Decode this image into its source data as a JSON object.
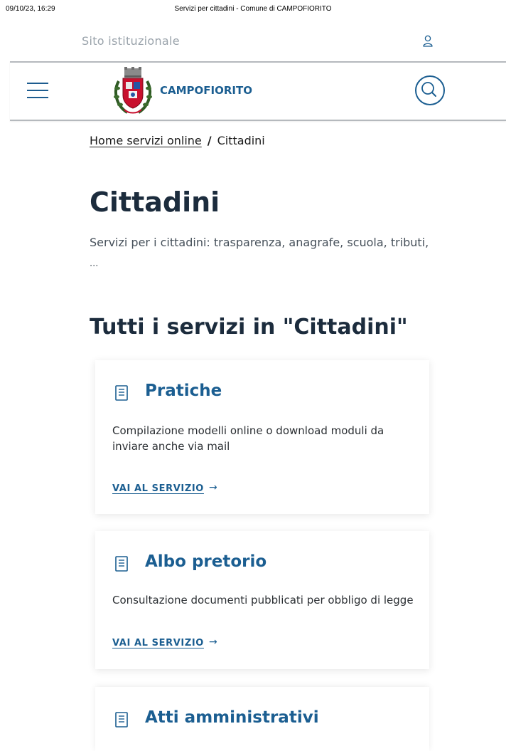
{
  "print_header": {
    "date": "09/10/23, 16:29",
    "title": "Servizi per cittadini - Comune di CAMPOFIORITO"
  },
  "slim_header": {
    "label": "Sito istituzionale",
    "user_icon": "user-icon"
  },
  "header": {
    "menu_icon": "hamburger-icon",
    "crest_icon": "municipal-crest-icon",
    "brand": "CAMPOFIORITO",
    "search_icon": "search-icon"
  },
  "breadcrumb": {
    "home": "Home servizi online",
    "separator": "/",
    "current": "Cittadini"
  },
  "page": {
    "title": "Cittadini",
    "description": "Servizi per i cittadini: trasparenza, anagrafe, scuola, tributi,",
    "description_more": "..."
  },
  "section": {
    "title": "Tutti i servizi in \"Cittadini\""
  },
  "cards": [
    {
      "title": "Pratiche",
      "text": "Compilazione modelli online o download moduli da inviare anche via mail",
      "link": "VAI AL SERVIZIO",
      "arrow": "→"
    },
    {
      "title": "Albo pretorio",
      "text": "Consultazione documenti pubblicati per obbligo di legge",
      "link": "VAI AL SERVIZIO",
      "arrow": "→"
    },
    {
      "title": "Atti amministrativi"
    }
  ],
  "colors": {
    "accent": "#1b5e91",
    "heading": "#1c2c3d",
    "muted": "#9aa3ab"
  }
}
